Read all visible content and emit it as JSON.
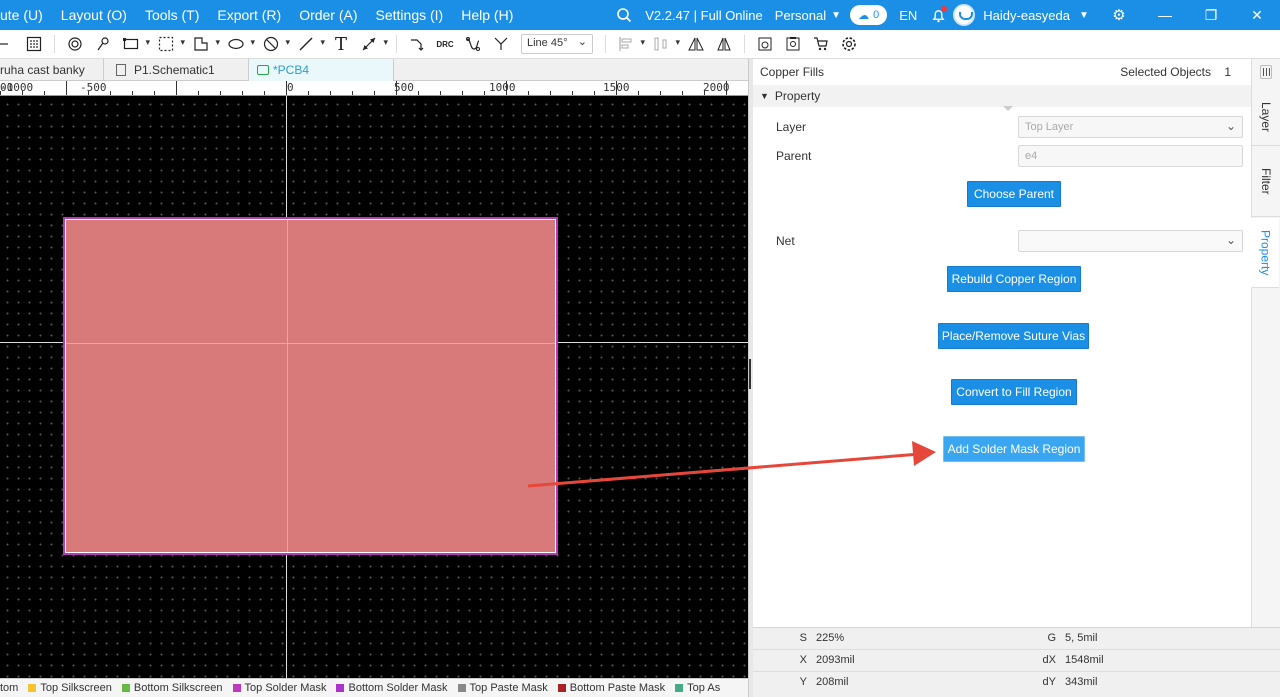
{
  "menubar": {
    "items": [
      "ute (U)",
      "Layout (O)",
      "Tools (T)",
      "Export (R)",
      "Order (A)",
      "Settings (I)",
      "Help (H)"
    ],
    "version": "V2.2.47 | Full Online",
    "workspace": "Personal",
    "cloud_count": "0",
    "language": "EN",
    "username": "Haidy-easyeda",
    "icons": {
      "search": "search-icon",
      "cloud": "cloud-upload-icon",
      "bell": "bell-icon",
      "gear": "gear-icon"
    }
  },
  "toolbar": {
    "line_mode": "Line 45°",
    "drc_label": "DRC"
  },
  "tabs": [
    {
      "label": "ruha cast banky",
      "active": false
    },
    {
      "label": "P1.Schematic1",
      "active": false
    },
    {
      "label": "*PCB4",
      "active": true
    }
  ],
  "ruler": {
    "labels": [
      "00",
      "-1000",
      "-500",
      "0",
      "500",
      "1000",
      "1500",
      "2000"
    ]
  },
  "layers": [
    {
      "name": "tom",
      "color": "#2a2a2a"
    },
    {
      "name": "Top Silkscreen",
      "color": "#f4c430"
    },
    {
      "name": "Bottom Silkscreen",
      "color": "#66bb44"
    },
    {
      "name": "Top Solder Mask",
      "color": "#c03ac0"
    },
    {
      "name": "Bottom Solder Mask",
      "color": "#aa33cc"
    },
    {
      "name": "Top Paste Mask",
      "color": "#888888"
    },
    {
      "name": "Bottom Paste Mask",
      "color": "#aa2222"
    },
    {
      "name": "Top As",
      "color": "#44aa88"
    }
  ],
  "panel": {
    "title": "Copper Fills",
    "selected_label": "Selected Objects",
    "selected_count": "1",
    "section": "Property",
    "layer_label": "Layer",
    "layer_value": "Top Layer",
    "parent_label": "Parent",
    "parent_value": "e4",
    "choose_parent": "Choose Parent",
    "net_label": "Net",
    "net_value": "",
    "rebuild": "Rebuild Copper Region",
    "suture": "Place/Remove Suture Vias",
    "convert": "Convert to Fill Region",
    "add_mask": "Add Solder Mask Region"
  },
  "sidetabs": [
    "Layer",
    "Filter",
    "Property"
  ],
  "status": {
    "S": "225%",
    "G": "5, 5mil",
    "X": "2093mil",
    "dX": "1548mil",
    "Y": "208mil",
    "dY": "343mil"
  },
  "colors": {
    "brand": "#1b8fe6",
    "copper_fill": "#d87a7a",
    "copper_outline": "#b43cb4",
    "annotation_arrow": "#e5483a"
  }
}
